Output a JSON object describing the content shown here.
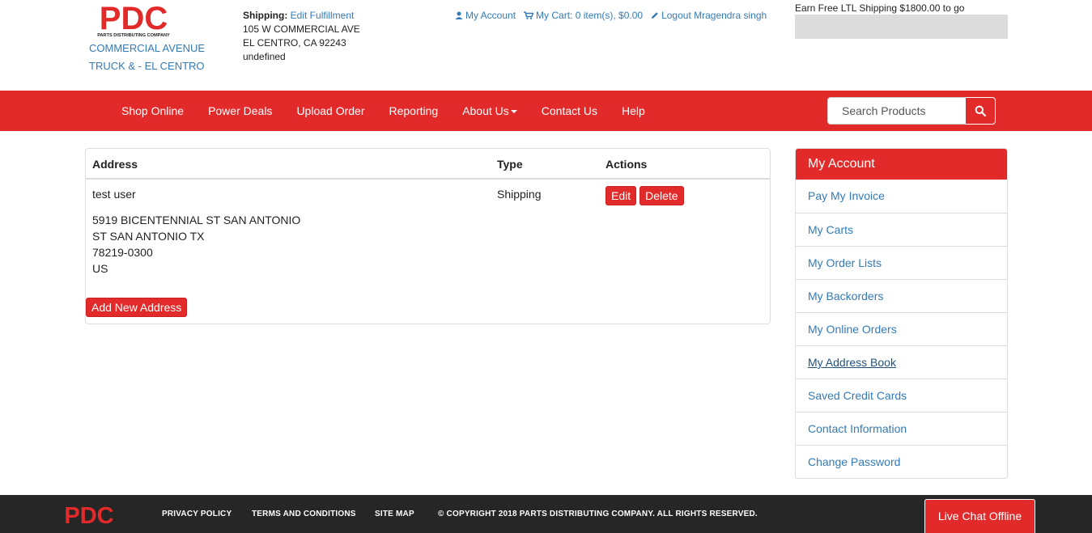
{
  "header": {
    "logo_text": "PDC",
    "logo_tagline": "PARTS DISTRIBUTING COMPANY",
    "store_line1": "COMMERCIAL AVENUE",
    "store_line2": "TRUCK & - EL CENTRO",
    "shipping_label": "Shipping:",
    "shipping_link": "Edit Fulfillment",
    "address_line1": "105 W COMMERCIAL AVE",
    "address_line2": "EL CENTRO, CA 92243",
    "address_line3": "undefined",
    "my_account": "My Account",
    "my_cart": "My Cart: 0 item(s), $0.00",
    "logout": "Logout Mragendra singh",
    "ltl_text": "Earn Free LTL Shipping $1800.00 to go",
    "ltl_progress": 0
  },
  "nav": {
    "items": [
      "Shop Online",
      "Power Deals",
      "Upload Order",
      "Reporting",
      "About Us",
      "Contact Us",
      "Help"
    ],
    "search_placeholder": "Search Products"
  },
  "addresses": {
    "headers": {
      "address": "Address",
      "type": "Type",
      "actions": "Actions"
    },
    "rows": [
      {
        "name": "test user",
        "lines": [
          "5919 BICENTENNIAL ST SAN ANTONIO",
          "ST SAN ANTONIO TX",
          "78219-0300",
          "US"
        ],
        "type": "Shipping",
        "edit": "Edit",
        "delete": "Delete"
      }
    ],
    "add_button": "Add New Address"
  },
  "account": {
    "title": "My Account",
    "items": [
      "Pay My Invoice",
      "My Carts",
      "My Order Lists",
      "My Backorders",
      "My Online Orders",
      "My Address Book",
      "Saved Credit Cards",
      "Contact Information",
      "Change Password"
    ],
    "active": "My Address Book"
  },
  "footer": {
    "logo_text": "PDC",
    "privacy": "PRIVACY POLICY",
    "terms": "TERMS AND CONDITIONS",
    "sitemap": "SITE MAP",
    "copyright": "© COPYRIGHT 2018 PARTS DISTRIBUTING COMPANY. ALL RIGHTS RESERVED.",
    "chat": "Live Chat Offline"
  },
  "colors": {
    "brand_red": "#e32a2a",
    "link_blue": "#337ab7",
    "footer_bg": "#262626"
  }
}
